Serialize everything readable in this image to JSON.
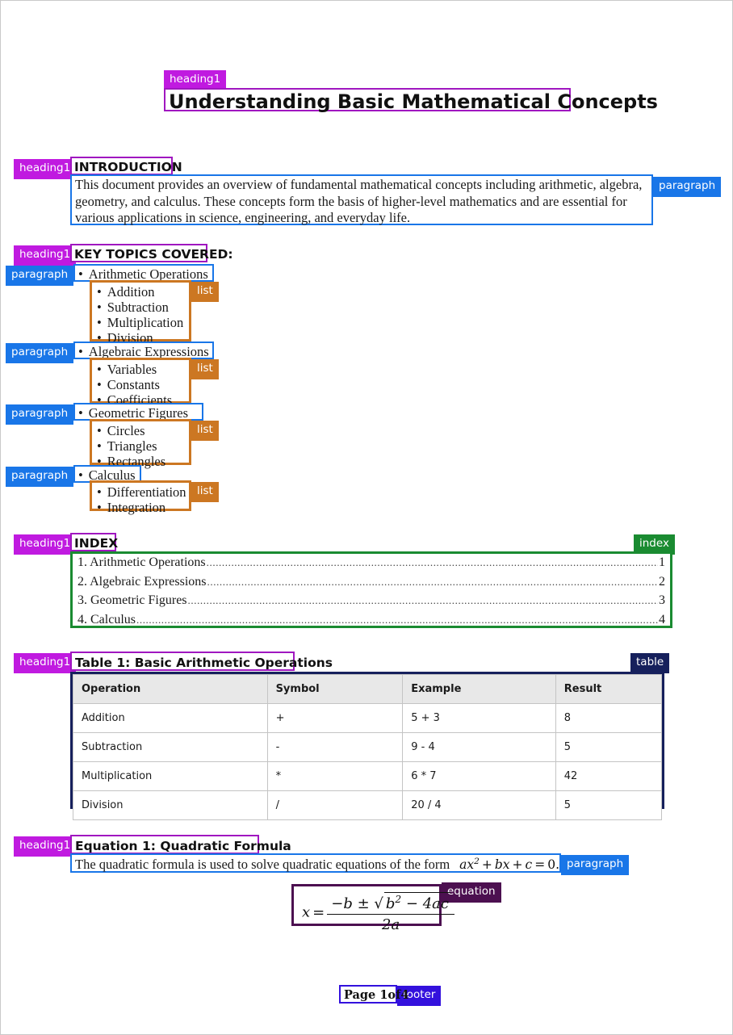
{
  "document": {
    "title": "Understanding Basic Mathematical Concepts"
  },
  "tags": {
    "heading1": "heading1",
    "paragraph": "paragraph",
    "list": "list",
    "index": "index",
    "table": "table",
    "equation": "equation",
    "footer": "footer"
  },
  "colors": {
    "heading1": "#c01ae0",
    "paragraph": "#1976e8",
    "list": "#cc7722",
    "index": "#1a8b31",
    "table": "#16205c",
    "equation": "#4c1050",
    "footer": "#3311dd",
    "table_header_bg": "#e8e8e8"
  },
  "sections": {
    "introduction": {
      "heading": "INTRODUCTION",
      "paragraph": "This document provides an overview of fundamental mathematical concepts including arithmetic, algebra, geometry, and calculus. These concepts form the basis of higher-level mathematics and are essential for various applications in science, engineering, and everyday life."
    },
    "key_topics": {
      "heading": "KEY TOPICS COVERED:",
      "topics": [
        {
          "title": "Arithmetic Operations",
          "items": [
            "Addition",
            "Subtraction",
            "Multiplication",
            "Division"
          ]
        },
        {
          "title": "Algebraic Expressions",
          "items": [
            "Variables",
            "Constants",
            "Coefficients"
          ]
        },
        {
          "title": "Geometric Figures",
          "items": [
            "Circles",
            "Triangles",
            "Rectangles"
          ]
        },
        {
          "title": "Calculus",
          "items": [
            "Differentiation",
            "Integration"
          ]
        }
      ]
    },
    "index": {
      "heading": "INDEX",
      "entries": [
        {
          "label": "1. Arithmetic Operations",
          "page": "1"
        },
        {
          "label": "2. Algebraic Expressions",
          "page": "2"
        },
        {
          "label": "3. Geometric Figures",
          "page": "3"
        },
        {
          "label": "4. Calculus",
          "page": "4"
        }
      ]
    },
    "table": {
      "heading": "Table 1: Basic Arithmetic Operations",
      "columns": [
        "Operation",
        "Symbol",
        "Example",
        "Result"
      ],
      "rows": [
        [
          "Addition",
          "+",
          "5 + 3",
          "8"
        ],
        [
          "Subtraction",
          "-",
          "9 - 4",
          "5"
        ],
        [
          "Multiplication",
          "*",
          "6 * 7",
          "42"
        ],
        [
          "Division",
          "/",
          "20 / 4",
          "5"
        ]
      ]
    },
    "equation": {
      "heading": "Equation 1: Quadratic Formula",
      "paragraph_prefix": "The quadratic formula is used to solve quadratic equations of the form",
      "inline_formula": "ax2 + bx + c = 0.",
      "display_formula": {
        "lhs": "x =",
        "numerator": "-b ± √(b² - 4ac)",
        "denominator": "2a"
      }
    }
  },
  "footer": {
    "text": "Page 1of4"
  },
  "bullet_glyph": "•"
}
